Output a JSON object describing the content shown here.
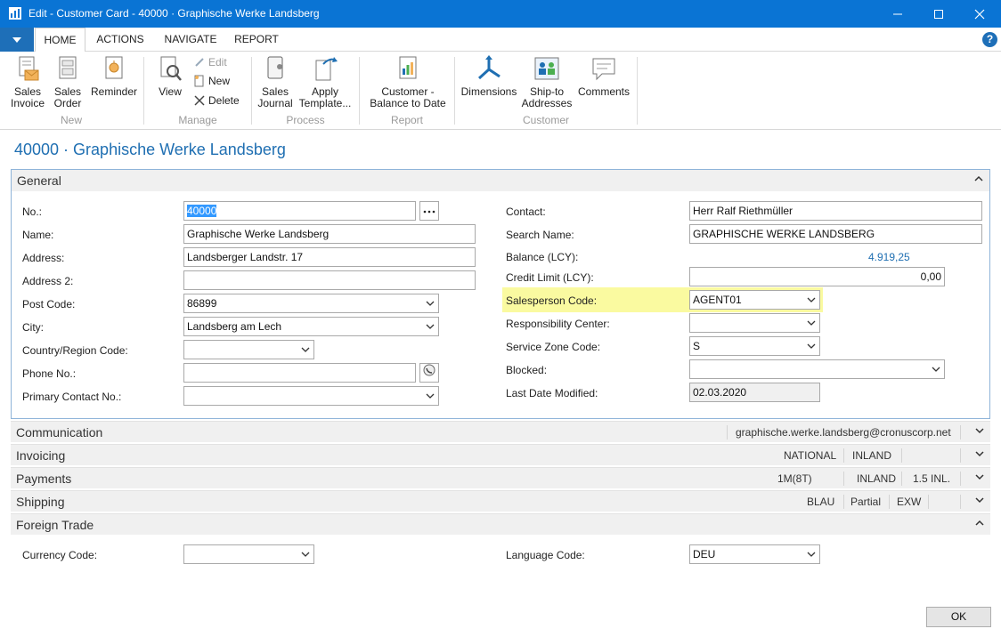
{
  "window": {
    "title": "Edit - Customer Card - 40000 · Graphische Werke Landsberg",
    "minimize": "—",
    "maximize": "☐",
    "close": "✕"
  },
  "ribbon_tabs": [
    {
      "label": "HOME",
      "active": true
    },
    {
      "label": "ACTIONS"
    },
    {
      "label": "NAVIGATE"
    },
    {
      "label": "REPORT"
    }
  ],
  "help": "?",
  "ribbon": {
    "groups": {
      "new": "New",
      "manage": "Manage",
      "process": "Process",
      "report": "Report",
      "customer": "Customer"
    },
    "buttons": {
      "sales_invoice": [
        "Sales",
        "Invoice"
      ],
      "sales_order": [
        "Sales",
        "Order"
      ],
      "reminder": "Reminder",
      "view": "View",
      "edit": "Edit",
      "new": "New",
      "delete": "Delete",
      "sales_journal": [
        "Sales",
        "Journal"
      ],
      "apply_template": [
        "Apply",
        "Template..."
      ],
      "customer_balance": [
        "Customer -",
        "Balance to Date"
      ],
      "dimensions": "Dimensions",
      "ship_to": [
        "Ship-to",
        "Addresses"
      ],
      "comments": "Comments"
    }
  },
  "page_title": "40000 · Graphische Werke Landsberg",
  "general": {
    "header": "General",
    "left": {
      "no_label": "No.:",
      "no_value": "40000",
      "name_label": "Name:",
      "name_value": "Graphische Werke Landsberg",
      "address_label": "Address:",
      "address_value": "Landsberger Landstr. 17",
      "address2_label": "Address 2:",
      "address2_value": "",
      "postcode_label": "Post Code:",
      "postcode_value": "86899",
      "city_label": "City:",
      "city_value": "Landsberg am Lech",
      "country_label": "Country/Region Code:",
      "country_value": "",
      "phone_label": "Phone No.:",
      "phone_value": "",
      "primary_contact_label": "Primary Contact No.:",
      "primary_contact_value": ""
    },
    "right": {
      "contact_label": "Contact:",
      "contact_value": "Herr Ralf Riethmüller",
      "search_name_label": "Search Name:",
      "search_name_value": "GRAPHISCHE WERKE LANDSBERG",
      "balance_label": "Balance (LCY):",
      "balance_value": "4.919,25",
      "credit_limit_label": "Credit Limit (LCY):",
      "credit_limit_value": "0,00",
      "salesperson_label": "Salesperson Code:",
      "salesperson_value": "AGENT01",
      "responsibility_label": "Responsibility Center:",
      "responsibility_value": "",
      "service_zone_label": "Service Zone Code:",
      "service_zone_value": "S",
      "blocked_label": "Blocked:",
      "blocked_value": "",
      "last_modified_label": "Last Date Modified:",
      "last_modified_value": "02.03.2020"
    }
  },
  "communication": {
    "header": "Communication",
    "summary": "graphische.werke.landsberg@cronuscorp.net"
  },
  "invoicing": {
    "header": "Invoicing",
    "summary": [
      "NATIONAL",
      "INLAND"
    ]
  },
  "payments": {
    "header": "Payments",
    "summary": [
      "1M(8T)",
      "INLAND",
      "1.5 INL."
    ]
  },
  "shipping": {
    "header": "Shipping",
    "summary": [
      "BLAU",
      "Partial",
      "EXW"
    ]
  },
  "foreign_trade": {
    "header": "Foreign Trade",
    "currency_label": "Currency Code:",
    "currency_value": "",
    "language_label": "Language Code:",
    "language_value": "DEU"
  },
  "ok": "OK",
  "colors": {
    "title_bar": "#0a74d4",
    "accent": "#1f6fb2",
    "highlight": "#fafaa0"
  }
}
